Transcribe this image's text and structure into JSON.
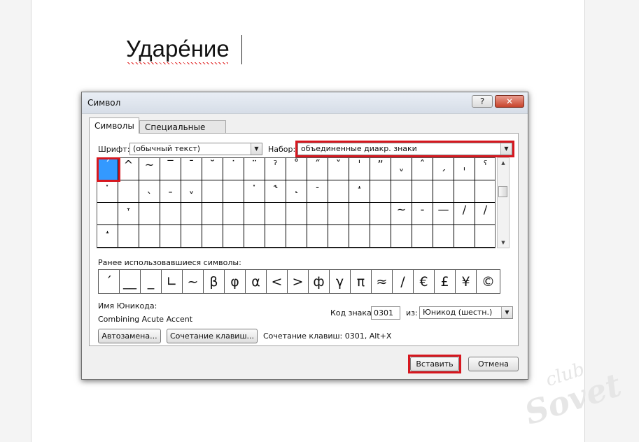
{
  "document": {
    "word": "Ударе́ние"
  },
  "dialog": {
    "title": "Символ",
    "help_button": "?",
    "close_button": "✕",
    "tabs": [
      {
        "label": "Символы",
        "active": true
      },
      {
        "label": "Специальные знаки",
        "active": false
      }
    ],
    "font_label": "Шрифт:",
    "font_value": "(обычный текст)",
    "subset_label": "Набор:",
    "subset_value": "объединенные диакр. знаки",
    "symbol_grid": {
      "selected_index": 0,
      "rows": [
        [
          "ˊ",
          "^",
          "~",
          "‾",
          "¯",
          "˘",
          "˙",
          "¨",
          "ˀ",
          "˚",
          "˝",
          "ˇ",
          "ˈ",
          "ˮ",
          "ˬ",
          "ˆ",
          "ˏ",
          "ˌ",
          "ˁ"
        ],
        [
          "ˑ",
          "",
          "ˎ",
          "ˍ",
          "ˬ",
          "",
          "",
          "ˑ",
          "˞",
          "˛",
          "˗",
          "",
          "˔",
          "",
          "",
          "",
          "",
          "",
          ""
        ],
        [
          "",
          "˕",
          "",
          "",
          "",
          "",
          "",
          "",
          "",
          "",
          "",
          "",
          "",
          "",
          "~",
          "-",
          "—",
          "/",
          "/"
        ],
        [
          "˔",
          "",
          "",
          "",
          "",
          "",
          "",
          "",
          "",
          "",
          "",
          "",
          "",
          "",
          "",
          "",
          "",
          "",
          ""
        ]
      ]
    },
    "recent_label": "Ранее использовавшиеся символы:",
    "recent_symbols": [
      "ˊ",
      "__",
      "_",
      "∟",
      "~",
      "β",
      "φ",
      "α",
      "<",
      ">",
      "ф",
      "γ",
      "π",
      "≈",
      "/",
      "€",
      "£",
      "¥",
      "©"
    ],
    "unicode_name_label": "Имя Юникода:",
    "unicode_name_value": "Combining Acute Accent",
    "char_code_label": "Код знака:",
    "char_code_value": "0301",
    "from_label": "из:",
    "from_value": "Юникод (шестн.)",
    "autocorrect_button": "Автозамена...",
    "shortcut_key_button": "Сочетание клавиш...",
    "shortcut_text": "Сочетание клавиш: 0301, Alt+X",
    "insert_button": "Вставить",
    "cancel_button": "Отмена"
  },
  "watermark": {
    "top": "club",
    "bottom": "Sovet"
  },
  "colors": {
    "highlight_red": "#d7171f",
    "selection_blue": "#3399ff"
  }
}
